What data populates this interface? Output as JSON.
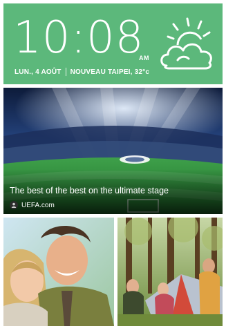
{
  "clock": {
    "time": "10:08",
    "ampm": "AM",
    "date": "LUN., 4 AOÛT",
    "location_temp": "NOUVEAU TAIPEI, 32°c",
    "weather_icon": "partly-cloudy-sun-icon"
  },
  "article": {
    "headline": "The best of the best on the ultimate stage",
    "source": "UEFA.com",
    "source_icon": "source-avatar-icon"
  },
  "colors": {
    "clock_panel": "#5cb87b",
    "pitch_green": "#2f8f3a",
    "stadium_blue": "#2a4c8c"
  }
}
